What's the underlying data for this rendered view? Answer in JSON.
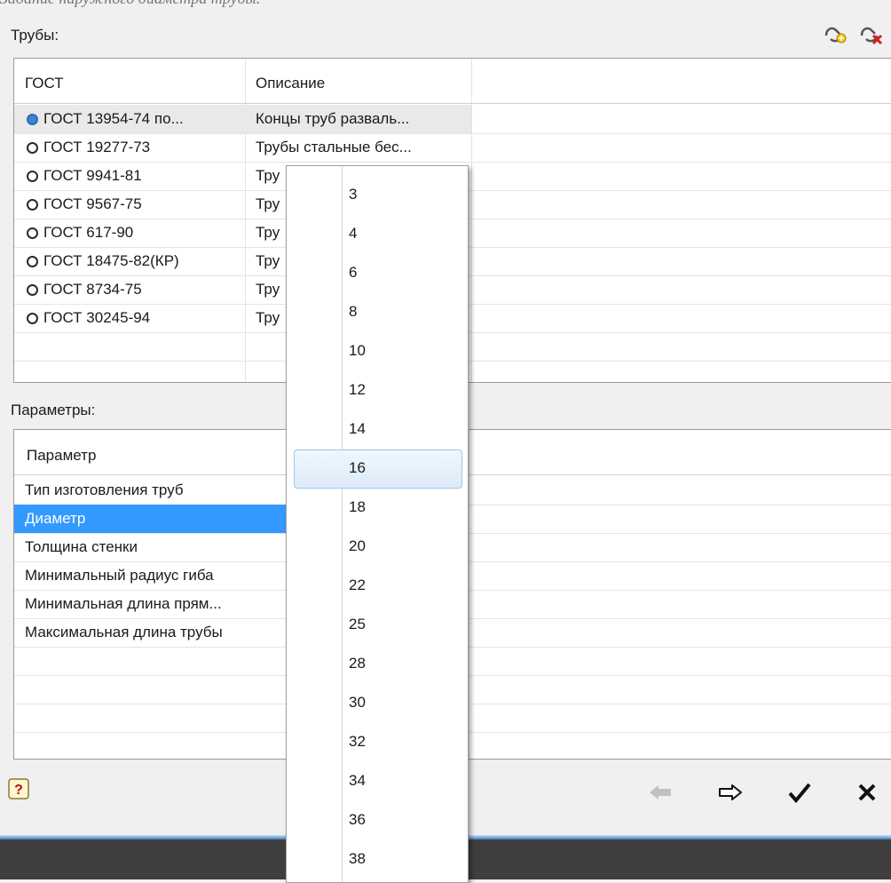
{
  "caption": "Задание наружного диаметра трубы.",
  "pipes_label": "Трубы:",
  "params_label": "Параметры:",
  "header_icons": [
    "pipe-add-icon",
    "pipe-delete-icon"
  ],
  "pipes_table": {
    "columns": [
      "ГОСТ",
      "Описание"
    ],
    "rows": [
      {
        "gost": "ГОСТ 13954-74 по...",
        "desc": "Концы труб разваль...",
        "selected": true
      },
      {
        "gost": "ГОСТ 19277-73",
        "desc": "Трубы стальные бес...",
        "selected": false
      },
      {
        "gost": "ГОСТ 9941-81",
        "desc": "Тру",
        "selected": false
      },
      {
        "gost": "ГОСТ 9567-75",
        "desc": "Тру",
        "selected": false
      },
      {
        "gost": "ГОСТ 617-90",
        "desc": "Тру",
        "selected": false
      },
      {
        "gost": "ГОСТ 18475-82(КР)",
        "desc": "Тру",
        "selected": false
      },
      {
        "gost": "ГОСТ 8734-75",
        "desc": "Тру",
        "selected": false
      },
      {
        "gost": "ГОСТ 30245-94",
        "desc": "Тру",
        "selected": false
      }
    ]
  },
  "params_table": {
    "columns": [
      "Параметр"
    ],
    "rows": [
      {
        "name": "Тип изготовления труб",
        "selected": false
      },
      {
        "name": "Диаметр",
        "selected": true
      },
      {
        "name": "Толщина стенки",
        "selected": false
      },
      {
        "name": "Минимальный радиус гиба",
        "selected": false
      },
      {
        "name": "Минимальная длина прям...",
        "selected": false
      },
      {
        "name": "Максимальная длина трубы",
        "selected": false
      }
    ]
  },
  "dropdown": {
    "options": [
      "3",
      "4",
      "6",
      "8",
      "10",
      "12",
      "14",
      "16",
      "18",
      "20",
      "22",
      "25",
      "28",
      "30",
      "32",
      "34",
      "36",
      "38"
    ],
    "highlighted": "16"
  },
  "footer": {
    "help_icon": "help-icon",
    "buttons": [
      "back-arrow-icon",
      "forward-arrow-icon",
      "checkmark-icon",
      "close-icon"
    ]
  }
}
